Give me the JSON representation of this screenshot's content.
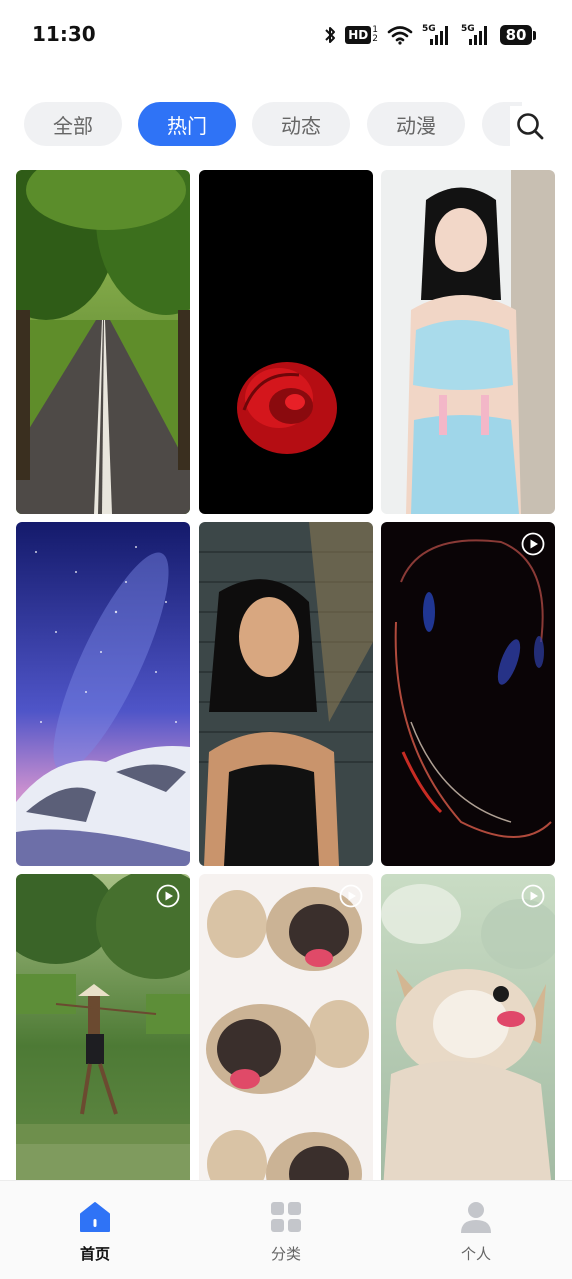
{
  "status_bar": {
    "time": "11:30",
    "hd_label": "HD",
    "hd_sub_top": "1",
    "hd_sub_bottom": "2",
    "signal_1_label": "5G",
    "signal_2_label": "5G",
    "battery_level": "80"
  },
  "tabs": [
    {
      "label": "全部",
      "active": false
    },
    {
      "label": "热门",
      "active": true
    },
    {
      "label": "动态",
      "active": false
    },
    {
      "label": "动漫",
      "active": false
    }
  ],
  "grid": {
    "items": [
      {
        "subject": "tree-lined road",
        "is_video": false
      },
      {
        "subject": "red rose on black",
        "is_video": false
      },
      {
        "subject": "woman portrait in light blue",
        "is_video": false
      },
      {
        "subject": "starry sky over snowy hills",
        "is_video": false
      },
      {
        "subject": "woman portrait in shadow",
        "is_video": false
      },
      {
        "subject": "abstract light curves on black",
        "is_video": true
      },
      {
        "subject": "farmer with rice seedlings",
        "is_video": true
      },
      {
        "subject": "pug dogs collage",
        "is_video": true
      },
      {
        "subject": "corgi puppy",
        "is_video": true
      }
    ]
  },
  "bottom_nav": {
    "items": [
      {
        "label": "首页",
        "icon": "home-icon",
        "active": true
      },
      {
        "label": "分类",
        "icon": "category-grid-icon",
        "active": false
      },
      {
        "label": "个人",
        "icon": "person-icon",
        "active": false
      }
    ]
  },
  "colors": {
    "accent": "#2f73f6",
    "tab_inactive_bg": "#f0f1f3",
    "nav_inactive": "#c4c6cb"
  }
}
